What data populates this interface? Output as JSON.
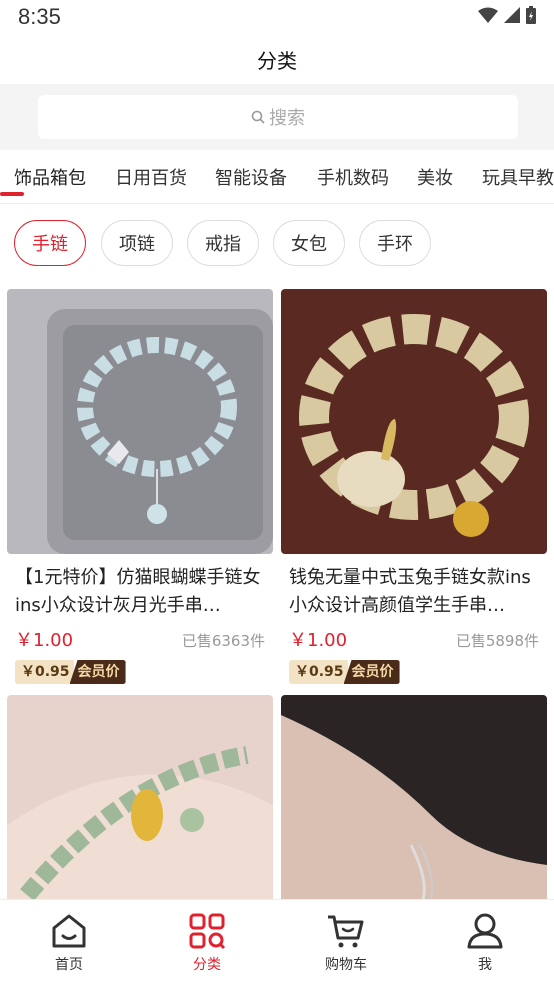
{
  "status_bar": {
    "time": "8:35"
  },
  "header": {
    "title": "分类"
  },
  "search": {
    "placeholder": "搜索"
  },
  "categories": [
    "饰品箱包",
    "日用百货",
    "智能设备",
    "手机数码",
    "美妆",
    "玩具早教"
  ],
  "active_category": "饰品箱包",
  "subcategories": [
    "手链",
    "项链",
    "戒指",
    "女包",
    "手环"
  ],
  "active_subcategory": "手链",
  "products": [
    {
      "title": "【1元特价】仿猫眼蝴蝶手链女ins小众设计灰月光手串…",
      "price": "￥1.00",
      "sold": "已售6363件",
      "vip_price": "￥0.95",
      "vip_label": "会员价"
    },
    {
      "title": "钱兔无量中式玉兔手链女款ins小众设计高颜值学生手串…",
      "price": "￥1.00",
      "sold": "已售5898件",
      "vip_price": "￥0.95",
      "vip_label": "会员价"
    },
    {
      "title": "",
      "price": "",
      "sold": "",
      "vip_price": "",
      "vip_label": ""
    },
    {
      "title": "",
      "price": "",
      "sold": "",
      "vip_price": "",
      "vip_label": ""
    }
  ],
  "nav": [
    {
      "label": "首页",
      "icon": "home-icon"
    },
    {
      "label": "分类",
      "icon": "category-icon"
    },
    {
      "label": "购物车",
      "icon": "cart-icon"
    },
    {
      "label": "我",
      "icon": "user-icon"
    }
  ],
  "colors": {
    "accent": "#e0212e",
    "vip_bg": "#f3e2c4",
    "vip_tag_bg": "#4a2a18"
  }
}
